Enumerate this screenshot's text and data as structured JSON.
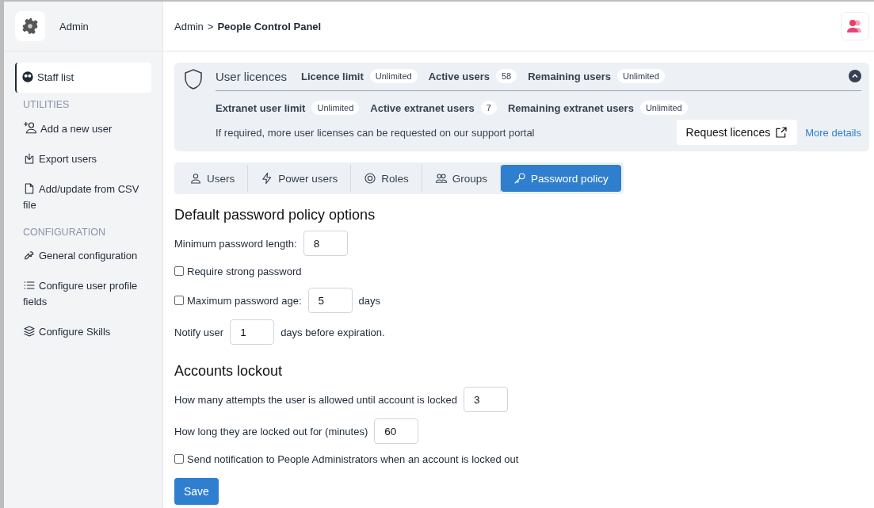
{
  "app": {
    "title": "Admin"
  },
  "breadcrumb": {
    "parent": "Admin",
    "separator": ">",
    "current": "People Control Panel"
  },
  "sidebar": {
    "items": [
      {
        "kind": "item",
        "label": "Staff list",
        "selected": true
      },
      {
        "kind": "heading",
        "label": "UTILITIES"
      },
      {
        "kind": "item",
        "label": "Add a new user",
        "selected": false
      },
      {
        "kind": "item",
        "label": "Export users",
        "selected": false
      },
      {
        "kind": "item",
        "label": "Add/update from CSV file",
        "selected": false
      },
      {
        "kind": "heading",
        "label": "CONFIGURATION"
      },
      {
        "kind": "item",
        "label": "General configuration",
        "selected": false
      },
      {
        "kind": "item",
        "label": "Configure user profile fields",
        "selected": false
      },
      {
        "kind": "item",
        "label": "Configure Skills",
        "selected": false
      }
    ]
  },
  "licences": {
    "title": "User licences",
    "expanded": true,
    "row_1": [
      {
        "label": "Licence limit",
        "value": "Unlimited"
      },
      {
        "label": "Active users",
        "value": "58"
      },
      {
        "label": "Remaining users",
        "value": "Unlimited"
      }
    ],
    "row_2": [
      {
        "label": "Extranet user limit",
        "value": "Unlimited"
      },
      {
        "label": "Active extranet users",
        "value": "7"
      },
      {
        "label": "Remaining extranet users",
        "value": "Unlimited"
      }
    ],
    "note": "If required, more user licenses can be requested on our support portal",
    "request_button": "Request licences",
    "more_link": "More details"
  },
  "tabs": [
    {
      "label": "Users",
      "selected": false
    },
    {
      "label": "Power users",
      "selected": false
    },
    {
      "label": "Roles",
      "selected": false
    },
    {
      "label": "Groups",
      "selected": false
    },
    {
      "label": "Password policy",
      "selected": true
    }
  ],
  "sections": [
    {
      "title": "Default password policy options",
      "rows": [
        {
          "kind": "field",
          "label": "Minimum password length:",
          "value": "8"
        },
        {
          "kind": "checkbox",
          "label": "Require strong password",
          "checked": false
        },
        {
          "kind": "checkbox-field",
          "label": "Maximum password age:",
          "checked": false,
          "value": "5",
          "suffix": "days"
        },
        {
          "kind": "field",
          "label": "Notify user",
          "value": "1",
          "suffix": "days before expiration."
        }
      ]
    },
    {
      "title": "Accounts lockout",
      "rows": [
        {
          "kind": "field",
          "label": "How many attempts the user is allowed until account is locked",
          "value": "3"
        },
        {
          "kind": "field",
          "label": "How long they are locked out for (minutes)",
          "value": "60"
        },
        {
          "kind": "checkbox",
          "label": "Send notification to People Administrators when an account is locked out",
          "checked": false
        }
      ]
    }
  ],
  "save_button": "Save"
}
